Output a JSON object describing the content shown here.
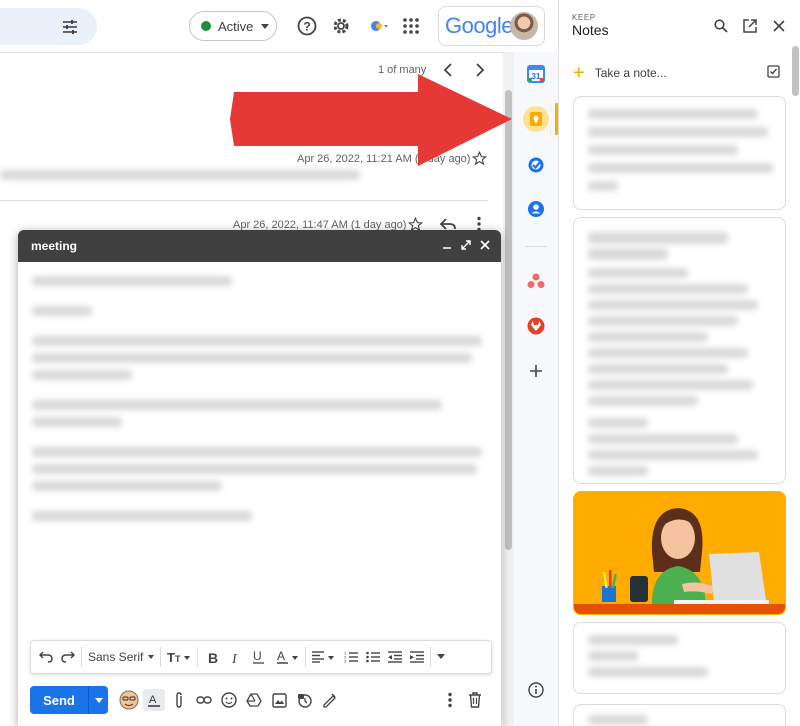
{
  "topbar": {
    "status_label": "Active",
    "status_color": "#1e8e3e",
    "google_logo_text": "Google",
    "icons": [
      "tune-icon",
      "help-icon",
      "gear-icon",
      "apps-icon"
    ]
  },
  "maillist": {
    "pagination": "1 of many",
    "message1_date": "Apr 26, 2022, 11:21 AM (1 day ago)",
    "message2_date": "Apr 26, 2022, 11:47 AM (1 day ago)"
  },
  "compose": {
    "title": "meeting",
    "font_family_label": "Sans Serif",
    "send_label": "Send",
    "accent_color": "#1a73e8"
  },
  "rail": {
    "items": [
      "calendar-icon",
      "keep-icon",
      "tasks-icon",
      "contacts-icon",
      "asana-icon",
      "gitlab-icon",
      "add-icon",
      "info-icon"
    ]
  },
  "keep": {
    "brand_small": "KEEP",
    "title": "Notes",
    "take_note_label": "Take a note...",
    "accent_color": "#f9ab00"
  }
}
